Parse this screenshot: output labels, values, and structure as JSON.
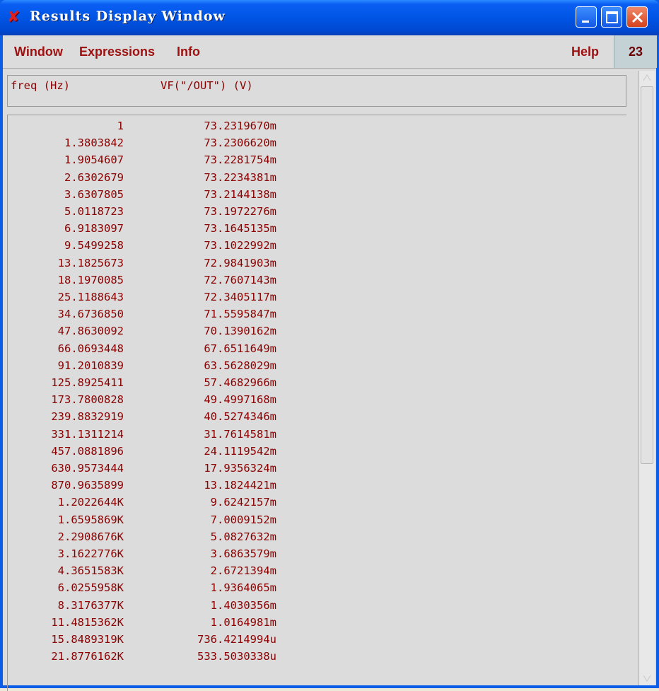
{
  "window": {
    "title": "Results Display Window",
    "buttons": {
      "minimize": "minimize-icon",
      "maximize": "maximize-icon",
      "close": "close-icon"
    }
  },
  "menu": {
    "items": [
      "Window",
      "Expressions",
      "Info"
    ],
    "help": "Help",
    "counter": "23"
  },
  "table": {
    "headers": {
      "freq": "freq (Hz)",
      "vf": "VF(\"/OUT\") (V)"
    },
    "rows": [
      [
        "1",
        "73.2319670m"
      ],
      [
        "1.3803842",
        "73.2306620m"
      ],
      [
        "1.9054607",
        "73.2281754m"
      ],
      [
        "2.6302679",
        "73.2234381m"
      ],
      [
        "3.6307805",
        "73.2144138m"
      ],
      [
        "5.0118723",
        "73.1972276m"
      ],
      [
        "6.9183097",
        "73.1645135m"
      ],
      [
        "9.5499258",
        "73.1022992m"
      ],
      [
        "13.1825673",
        "72.9841903m"
      ],
      [
        "18.1970085",
        "72.7607143m"
      ],
      [
        "25.1188643",
        "72.3405117m"
      ],
      [
        "34.6736850",
        "71.5595847m"
      ],
      [
        "47.8630092",
        "70.1390162m"
      ],
      [
        "66.0693448",
        "67.6511649m"
      ],
      [
        "91.2010839",
        "63.5628029m"
      ],
      [
        "125.8925411",
        "57.4682966m"
      ],
      [
        "173.7800828",
        "49.4997168m"
      ],
      [
        "239.8832919",
        "40.5274346m"
      ],
      [
        "331.1311214",
        "31.7614581m"
      ],
      [
        "457.0881896",
        "24.1119542m"
      ],
      [
        "630.9573444",
        "17.9356324m"
      ],
      [
        "870.9635899",
        "13.1824421m"
      ],
      [
        "1.2022644K",
        "9.6242157m"
      ],
      [
        "1.6595869K",
        "7.0009152m"
      ],
      [
        "2.2908676K",
        "5.0827632m"
      ],
      [
        "3.1622776K",
        "3.6863579m"
      ],
      [
        "4.3651583K",
        "2.6721394m"
      ],
      [
        "6.0255958K",
        "1.9364065m"
      ],
      [
        "8.3176377K",
        "1.4030356m"
      ],
      [
        "11.4815362K",
        "1.0164981m"
      ],
      [
        "15.8489319K",
        "736.4214994u"
      ],
      [
        "21.8776162K",
        "533.5030338u"
      ]
    ]
  },
  "colors": {
    "text": "#8b0000",
    "menu": "#a01010",
    "titlebar": "#0055e5"
  }
}
